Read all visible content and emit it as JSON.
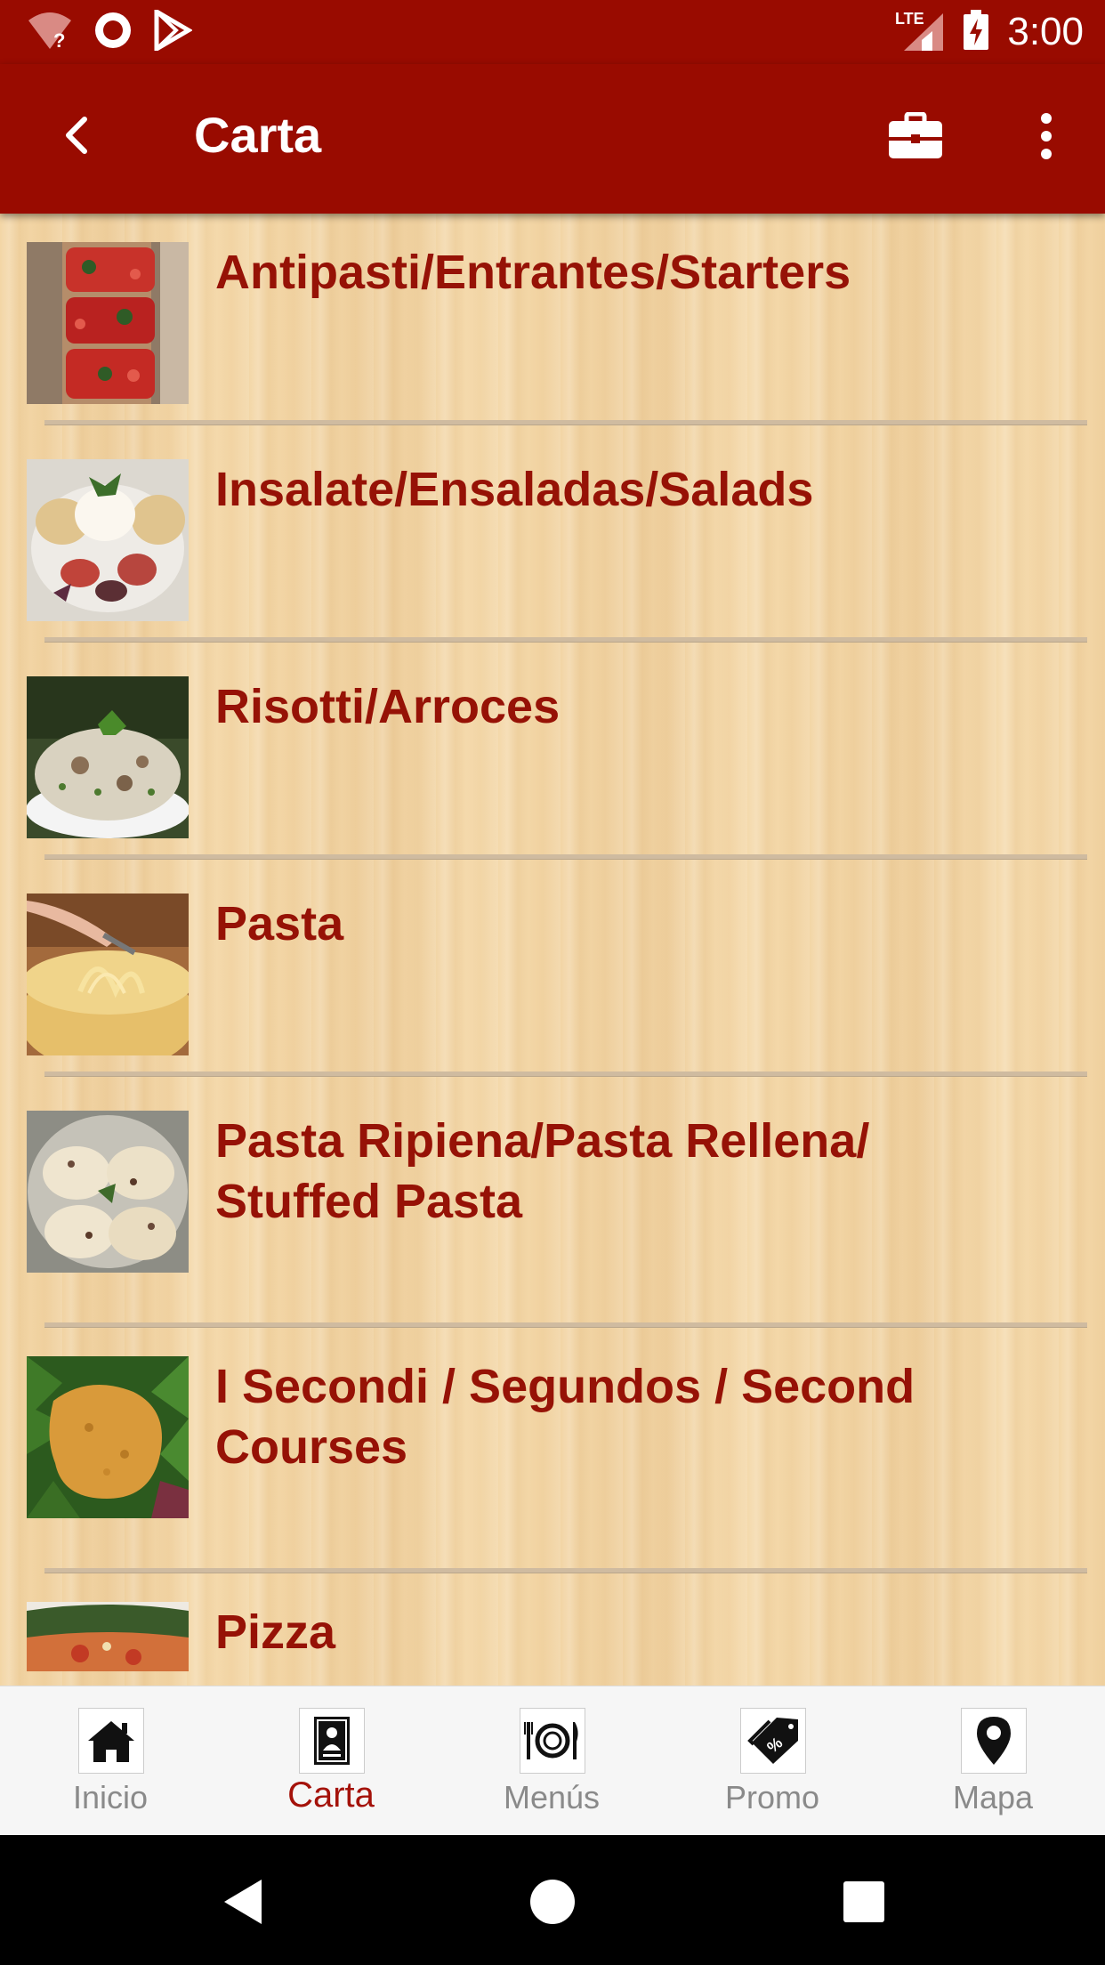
{
  "status_bar": {
    "time": "3:00",
    "network": "LTE"
  },
  "app_bar": {
    "title": "Carta"
  },
  "menu_categories": [
    {
      "label": "Antipasti/Entrantes/Starters",
      "image": "bruschetta-image"
    },
    {
      "label": "Insalate/Ensaladas/Salads",
      "image": "salad-image"
    },
    {
      "label": "Risotti/Arroces",
      "image": "risotto-image"
    },
    {
      "label": "Pasta",
      "image": "pasta-image"
    },
    {
      "label": "Pasta Ripiena/Pasta Rellena/ Stuffed Pasta",
      "image": "stuffed-pasta-image"
    },
    {
      "label": "I Secondi / Segundos / Second Courses",
      "image": "cutlet-image"
    },
    {
      "label": "Pizza",
      "image": "pizza-image"
    }
  ],
  "bottom_nav": {
    "items": [
      {
        "label": "Inicio",
        "icon": "home-icon"
      },
      {
        "label": "Carta",
        "icon": "menu-card-icon",
        "active": true
      },
      {
        "label": "Menús",
        "icon": "plate-cutlery-icon"
      },
      {
        "label": "Promo",
        "icon": "tag-percent-icon"
      },
      {
        "label": "Mapa",
        "icon": "map-pin-icon"
      }
    ]
  },
  "colors": {
    "primary": "#990b00",
    "item_text": "#961206",
    "active_nav": "#a4120a",
    "inactive_nav": "#8a8a8a",
    "background_wood": "#f3d6a6"
  }
}
